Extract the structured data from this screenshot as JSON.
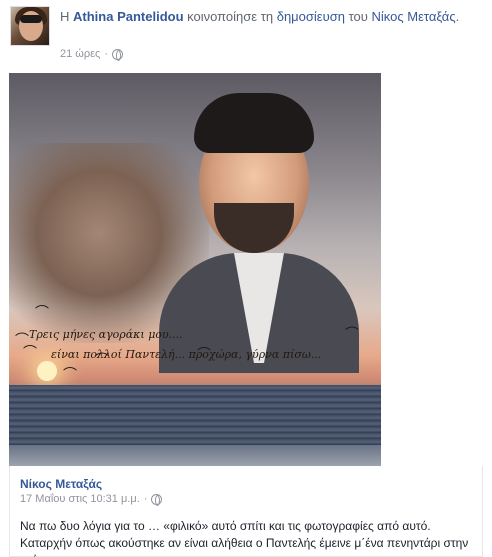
{
  "post": {
    "verb_prefix": "Η",
    "actor": "Athina Pantelidou",
    "verb": "κοινοποίησε τη",
    "object": "δημοσίευση",
    "preposition": "του",
    "original_author": "Νίκος Μεταξάς",
    "suffix": ".",
    "time": "21 ώρες",
    "separator": "·",
    "privacy_icon": "globe-icon"
  },
  "photo": {
    "caption_line1": "Τρεις μήνες αγοράκι μου....",
    "caption_line2": "είναι πολλοί Παντελή... προχώρα, γύρνα πίσω..."
  },
  "shared": {
    "author": "Νίκος Μεταξάς",
    "time": "17 Μαΐου στις 10:31 μ.μ.",
    "separator": "·",
    "privacy_icon": "globe-icon",
    "text": "Να πω δυο λόγια για το … «φιλικό» αυτό σπίτι και τις φωτογραφίες από αυτό. Καταρχήν όπως ακούστηκε αν είναι αλήθεια ο Παντελής έμεινε μ΄ένα πενηντάρι στην τσέπη..."
  },
  "colors": {
    "link": "#365899",
    "meta": "#90949c",
    "text": "#1d2129"
  }
}
